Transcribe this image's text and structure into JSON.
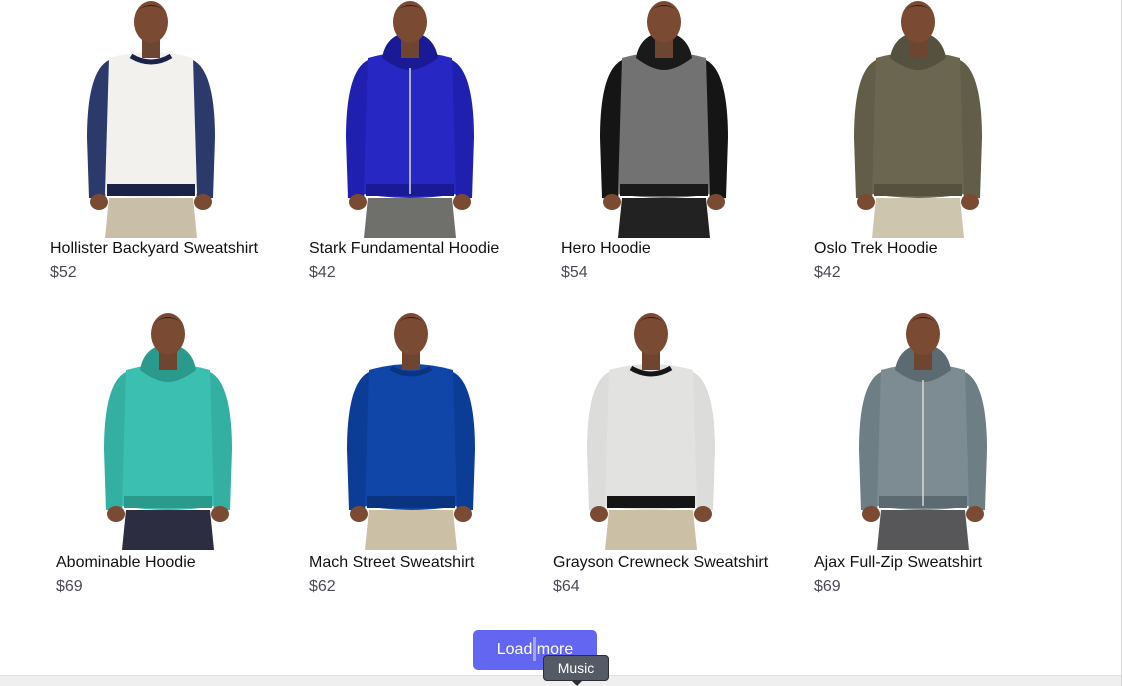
{
  "products": [
    {
      "name": "Hollister Backyard Sweatshirt",
      "price": "$52",
      "image": "man-white-sweatshirt-navy-sleeves",
      "colors": {
        "body": "#f2f1ee",
        "sleeve": "#2b3a6b",
        "trim": "#1b2248",
        "pants": "#c9bfa8"
      }
    },
    {
      "name": "Stark Fundamental Hoodie",
      "price": "$42",
      "image": "man-blue-zip-hoodie",
      "colors": {
        "body": "#2727c4",
        "sleeve": "#2020b0",
        "trim": "#1a1a96",
        "pants": "#6f6f6c"
      }
    },
    {
      "name": "Hero Hoodie",
      "price": "$54",
      "image": "man-gray-black-hoodie",
      "colors": {
        "body": "#727272",
        "sleeve": "#151515",
        "trim": "#1a1a1a",
        "pants": "#222222"
      }
    },
    {
      "name": "Oslo Trek Hoodie",
      "price": "$42",
      "image": "man-olive-hoodie",
      "colors": {
        "body": "#6b6650",
        "sleeve": "#625d48",
        "trim": "#55513f",
        "pants": "#cdc5ad"
      }
    },
    {
      "name": "Abominable Hoodie",
      "price": "$69",
      "image": "man-teal-hoodie",
      "colors": {
        "body": "#3bbfb0",
        "sleeve": "#34b0a2",
        "trim": "#2a9a8d",
        "pants": "#2c2d40"
      }
    },
    {
      "name": "Mach Street Sweatshirt",
      "price": "$62",
      "image": "man-blue-long-sleeve",
      "colors": {
        "body": "#0f46a8",
        "sleeve": "#0c3d96",
        "trim": "#0a3380",
        "pants": "#cbbfa6"
      }
    },
    {
      "name": "Grayson Crewneck Sweatshirt",
      "price": "$64",
      "image": "man-light-gray-crewneck",
      "colors": {
        "body": "#e2e2e0",
        "sleeve": "#dcdcda",
        "trim": "#151515",
        "pants": "#cbbfa6"
      }
    },
    {
      "name": "Ajax Full-Zip Sweatshirt",
      "price": "$69",
      "image": "man-striped-gray-zip",
      "colors": {
        "body": "#7d8c92",
        "sleeve": "#6e7e85",
        "trim": "#5c6b72",
        "pants": "#57575a"
      }
    }
  ],
  "load_more": {
    "label": "Load more"
  },
  "tooltip": {
    "label": "Music"
  },
  "accent_color": "#6366f1"
}
